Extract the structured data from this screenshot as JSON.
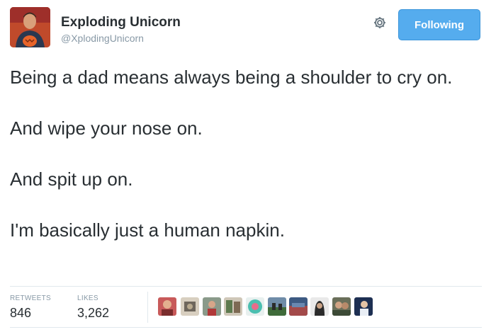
{
  "tweet": {
    "author": {
      "display_name": "Exploding Unicorn",
      "handle": "@XplodingUnicorn",
      "avatar_icon": "profile-photo"
    },
    "follow_button_label": "Following",
    "settings_icon": "gear-icon",
    "text_paragraphs": [
      "Being a dad means always being a shoulder to cry on.",
      "And wipe your nose on.",
      "And spit up on.",
      "I'm basically just a human napkin."
    ],
    "stats": {
      "retweets_label": "RETWEETS",
      "retweets_count": "846",
      "likes_label": "LIKES",
      "likes_count": "3,262"
    },
    "colors": {
      "accent": "#55acee",
      "text": "#292f33",
      "muted": "#8899a6",
      "divider": "#e1e8ed"
    }
  }
}
